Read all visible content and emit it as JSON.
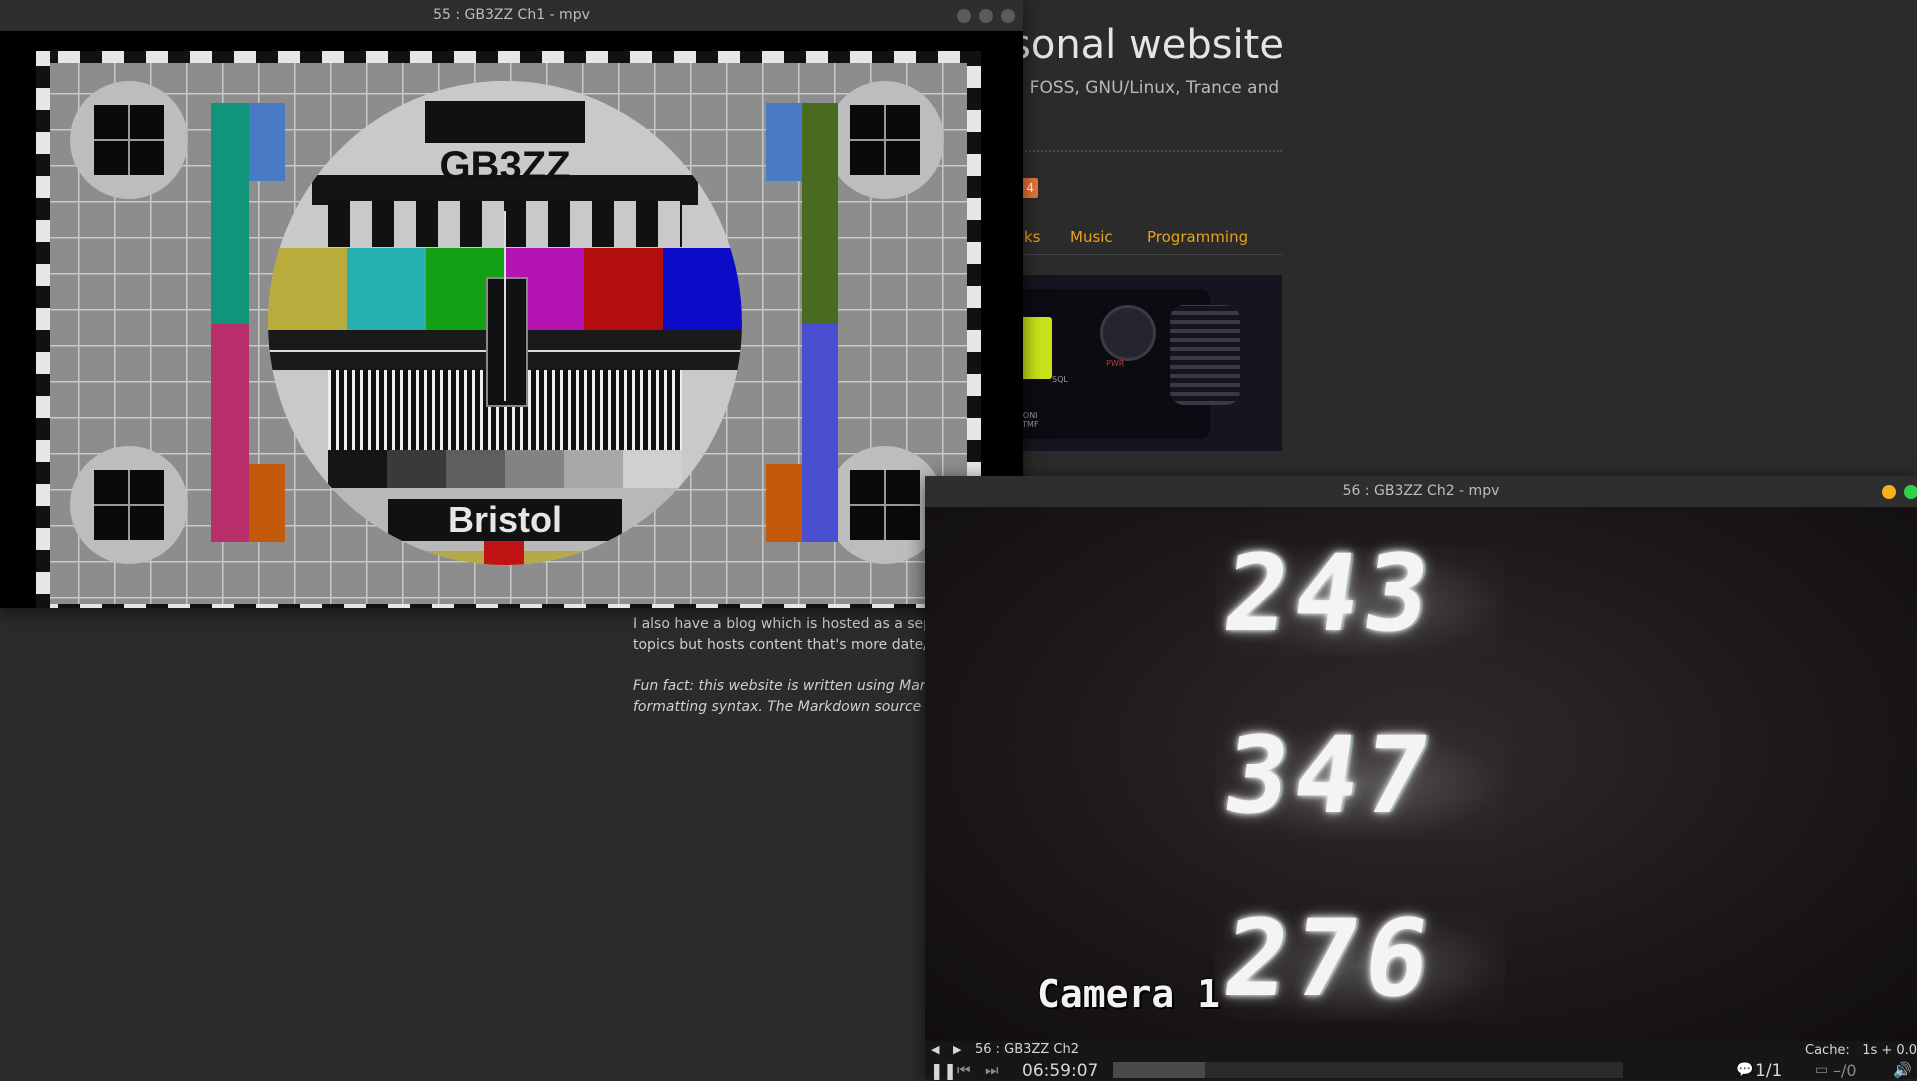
{
  "website": {
    "title": "sonal website",
    "subtitle": "s, FOSS, GNU/Linux, Trance and",
    "badge": "4",
    "nav": [
      "ks",
      "Music",
      "Programming"
    ],
    "hero_labels": {
      "sql": "SQL",
      "moni": "MONI\nDTMF",
      "pwr": "PWR"
    },
    "blog_text": "I also have a blog which is hosted as a separa\ntopics but hosts content that's more date/tim",
    "fun_fact": "Fun fact: this website is written using Markdo\nformatting syntax. The Markdown source file"
  },
  "window1": {
    "title": "55 : GB3ZZ Ch1 - mpv",
    "testcard": {
      "callsign": "GB3ZZ",
      "location": "Bristol",
      "colors": [
        "#b8ad3c",
        "#27b0b0",
        "#14a014",
        "#b514b5",
        "#b30e0e",
        "#0c0cc8"
      ]
    }
  },
  "window2": {
    "title": "56 : GB3ZZ Ch2 - mpv",
    "lcd_readings": [
      "243",
      "347",
      "276"
    ],
    "osd_text": "Camera 1",
    "controls": {
      "media_title": "56 : GB3ZZ Ch2",
      "time": "06:59:07",
      "cache": "Cache:   1s + 0.0",
      "chapters": "1/1",
      "subs": "–/0"
    },
    "playback_progress": 0.18
  },
  "colors": {
    "accent_link": "#e8a21b",
    "badge": "#e8753a",
    "win_yellow": "#f5b21b",
    "win_green": "#2fd24a"
  }
}
